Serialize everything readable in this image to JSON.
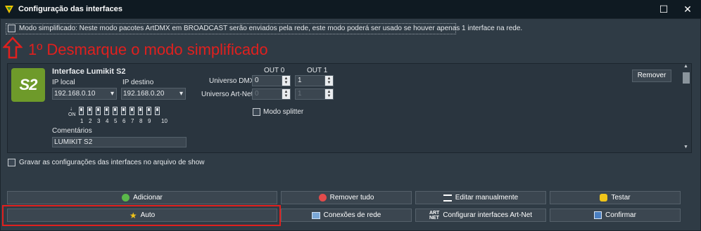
{
  "window": {
    "title": "Configuração das interfaces"
  },
  "simplified_mode": {
    "label": "Modo simplificado: Neste modo pacotes ArtDMX em BROADCAST serão enviados pela rede, este modo poderá ser usado se houver apenas 1 interface na rede.",
    "checked": false
  },
  "annotation": {
    "text": "1º Desmarque o modo simplificado"
  },
  "interface": {
    "logo_text": "S2",
    "name": "Interface Lumikit S2",
    "ip_local_label": "IP local",
    "ip_local_value": "192.168.0.10",
    "ip_dest_label": "IP destino",
    "ip_dest_value": "192.168.0.20",
    "dip_on_label": "ON",
    "dip_numbers": [
      "1",
      "2",
      "3",
      "4",
      "5",
      "6",
      "7",
      "8",
      "9",
      "10"
    ],
    "comments_label": "Comentários",
    "comments_value": "LUMIKIT S2",
    "out0_label": "OUT 0",
    "out1_label": "OUT 1",
    "universe_dmx_label": "Universo DMX",
    "universe_artnet_label": "Universo Art-Net",
    "dmx_out0": "0",
    "dmx_out1": "1",
    "artnet_out0": "0",
    "artnet_out1": "1",
    "splitter_label": "Modo splitter",
    "remove_label": "Remover"
  },
  "save_in_show": {
    "label": "Gravar as configurações das interfaces no arquivo de show",
    "checked": false
  },
  "buttons": {
    "add": "Adicionar",
    "remove_all": "Remover tudo",
    "edit_manual": "Editar manualmente",
    "test": "Testar",
    "auto": "Auto",
    "network_connections": "Conexões de rede",
    "configure_artnet": "Configurar interfaces Art-Net",
    "confirm": "Confirmar"
  },
  "colors": {
    "accent_red": "#e0201e",
    "logo_green": "#6e9a2a"
  }
}
